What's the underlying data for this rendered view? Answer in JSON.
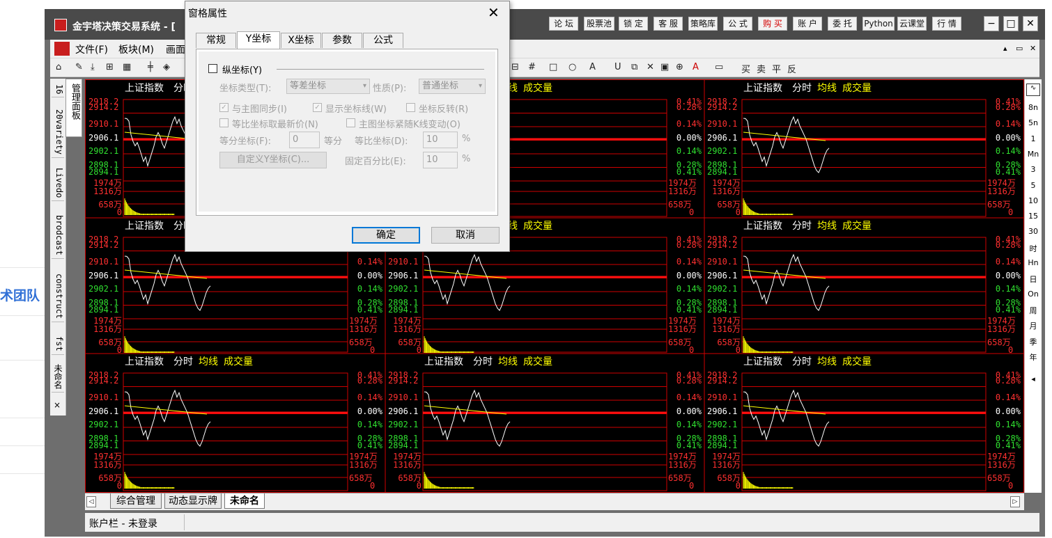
{
  "background": {
    "side_text": "术团队"
  },
  "window": {
    "title": "金宇塔决策交易系统 - [",
    "top_buttons": [
      {
        "label": "论 坛",
        "red": false
      },
      {
        "label": "股票池",
        "red": false
      },
      {
        "label": "锁 定",
        "red": false
      },
      {
        "label": "客 服",
        "red": false
      },
      {
        "label": "策略库",
        "red": false
      },
      {
        "label": "公 式",
        "red": false
      },
      {
        "label": "购 买",
        "red": true
      },
      {
        "label": "账 户",
        "red": false
      },
      {
        "label": "委 托",
        "red": false
      },
      {
        "label": "Python",
        "red": false
      },
      {
        "label": "云课堂",
        "red": false
      },
      {
        "label": "行 情",
        "red": false
      }
    ],
    "controls": {
      "minimize": "−",
      "maximize": "□",
      "close": "✕"
    }
  },
  "menu": {
    "items": [
      "文件(F)",
      "板块(M)",
      "画面"
    ],
    "right_controls": [
      "▴",
      "▭",
      "✕"
    ]
  },
  "toolbar": {
    "right_labels": [
      "买",
      "卖",
      "平",
      "反"
    ]
  },
  "left_tabs": [
    "16",
    "20variety",
    "Livedo",
    "brodcast",
    "construct",
    "fst",
    "未命名"
  ],
  "left_tab_close": "×",
  "mgmt_tab": "管理面板",
  "right_periods": [
    "8n",
    "5n",
    "1",
    "Mn",
    "3",
    "5",
    "10",
    "15",
    "30",
    "时",
    "Hn",
    "日",
    "On",
    "周",
    "月",
    "季",
    "年"
  ],
  "bottom_tabs": [
    {
      "label": "综合管理",
      "active": false
    },
    {
      "label": "动态显示牌",
      "active": false
    },
    {
      "label": "未命名",
      "active": true
    }
  ],
  "status": {
    "text": "账户栏 - 未登录"
  },
  "chart_panels": {
    "header": {
      "index": "上证指数",
      "type": "分时",
      "avg": "均线",
      "vol": "成交量"
    },
    "price_labels": [
      "2918.2",
      "2914.2",
      "2910.1",
      "2906.1",
      "2902.1",
      "2898.1",
      "2894.1"
    ],
    "pct_labels": [
      "0.41%",
      "0.28%",
      "0.14%",
      "0.00%",
      "0.14%",
      "0.28%",
      "0.41%"
    ],
    "vol_labels": [
      "1974万",
      "1316万",
      "658万",
      "0"
    ],
    "colors": {
      "up": "#ff3030",
      "down": "#30e030",
      "flat": "#ffffff",
      "volume": "#ffff00",
      "avg_line": "#ffff00",
      "grid": "#d00000",
      "ref_line": "#ff1010"
    }
  },
  "dialog": {
    "title": "窗格属性",
    "close": "✕",
    "tabs": [
      {
        "label": "常规",
        "active": false
      },
      {
        "label": "Y坐标",
        "active": true
      },
      {
        "label": "X坐标",
        "active": false
      },
      {
        "label": "参数",
        "active": false
      },
      {
        "label": "公式",
        "active": false
      }
    ],
    "vertical_axis": {
      "label": "纵坐标(Y)",
      "checked": false
    },
    "axis_type": {
      "label": "坐标类型(T):",
      "value": "等差坐标"
    },
    "nature": {
      "label": "性质(P):",
      "value": "普通坐标"
    },
    "sync_main": {
      "label": "与主图同步(I)",
      "checked": true
    },
    "show_axis_line": {
      "label": "显示坐标线(W)",
      "checked": true
    },
    "reverse_axis": {
      "label": "坐标反转(R)",
      "checked": false
    },
    "ratio_latest": {
      "label": "等比坐标取最新价(N)",
      "checked": false
    },
    "follow_k": {
      "label": "主图坐标紧随K线变动(O)",
      "checked": false
    },
    "equal_diff": {
      "label": "等分坐标(F):",
      "value": "0",
      "unit": "等分"
    },
    "ratio_coord": {
      "label": "等比坐标(D):",
      "value": "10",
      "unit": "%"
    },
    "custom_y": {
      "label": "自定义Y坐标(C)..."
    },
    "fixed_pct": {
      "label": "固定百分比(E):",
      "value": "10",
      "unit": "%"
    },
    "ok": "确定",
    "cancel": "取消"
  }
}
